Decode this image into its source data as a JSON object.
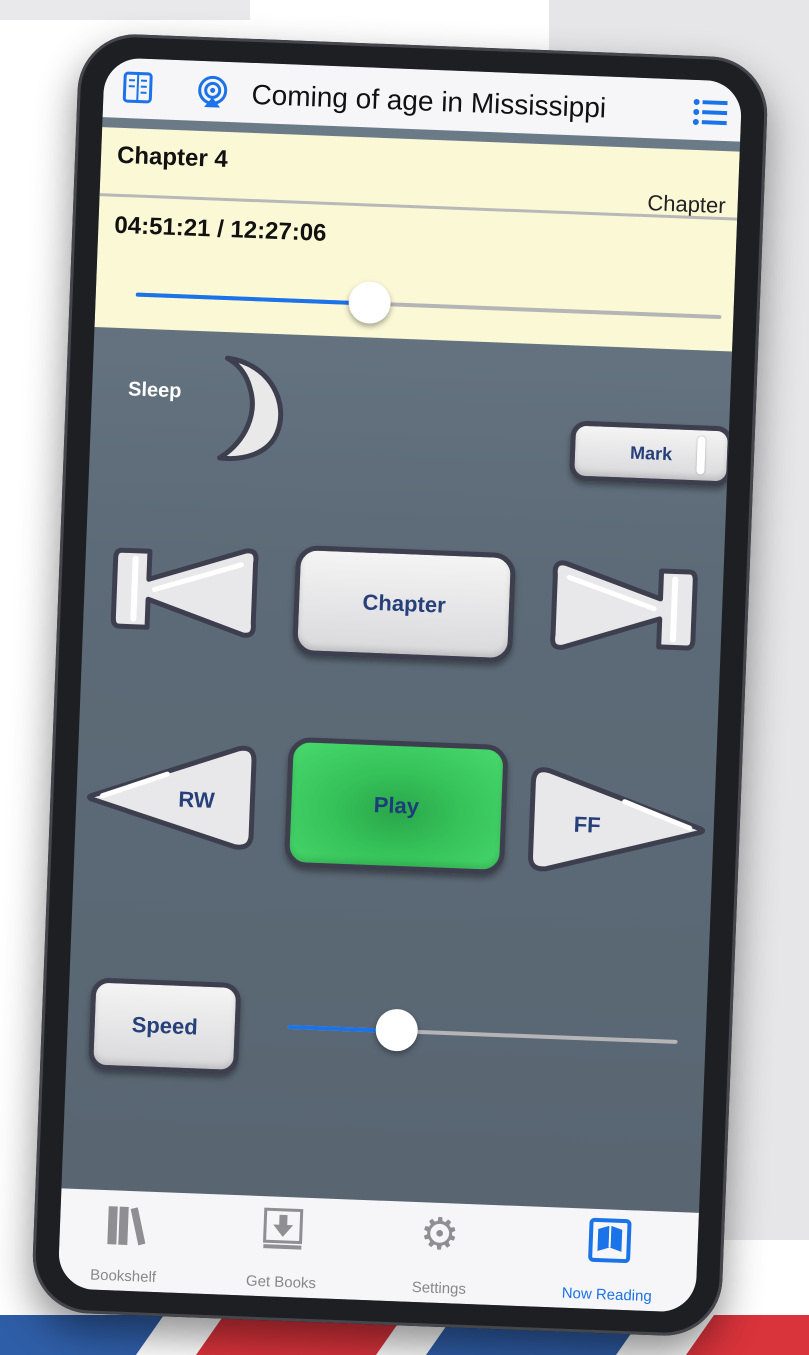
{
  "header": {
    "title": "Coming of age in Mississippi",
    "left_icon": "book-icon",
    "airplay_icon": "airplay-icon",
    "menu_icon": "list-icon"
  },
  "info": {
    "chapter": "Chapter 4",
    "mode": "Chapter",
    "time": "04:51:21 / 12:27:06",
    "progress": 0.4
  },
  "controls": {
    "sleep_label": "Sleep",
    "mark_label": "Mark",
    "chapter_label": "Chapter",
    "rw_label": "RW",
    "play_label": "Play",
    "ff_label": "FF",
    "speed_label": "Speed",
    "speed_level": 0.28
  },
  "tabs": [
    {
      "label": "Bookshelf",
      "icon": "bookshelf-icon"
    },
    {
      "label": "Get Books",
      "icon": "download-icon"
    },
    {
      "label": "Settings",
      "icon": "gear-icon"
    },
    {
      "label": "Now Reading",
      "icon": "open-book-icon",
      "active": true
    }
  ],
  "colors": {
    "accent": "#1a73e8",
    "play": "#36c45a",
    "panel": "#fbf8d6"
  }
}
